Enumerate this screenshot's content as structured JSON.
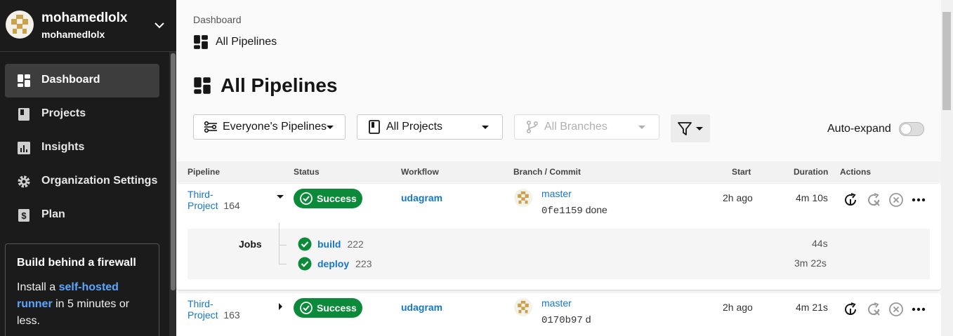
{
  "org": {
    "name": "mohamedlolx",
    "sub": "mohamedlolx"
  },
  "nav": [
    {
      "label": "Dashboard",
      "icon": "dashboard-icon",
      "active": true
    },
    {
      "label": "Projects",
      "icon": "book-icon"
    },
    {
      "label": "Insights",
      "icon": "bar-chart-icon"
    },
    {
      "label": "Organization Settings",
      "icon": "gear-icon"
    },
    {
      "label": "Plan",
      "icon": "dollar-icon"
    }
  ],
  "promo": {
    "title": "Build behind a firewall",
    "text_pre": "Install a ",
    "link": "self-hosted runner",
    "text_post": " in 5 minutes or less."
  },
  "breadcrumb": "Dashboard",
  "subheader": "All Pipelines",
  "title": "All Pipelines",
  "filters": {
    "pipelines": "Everyone's Pipelines",
    "projects": "All Projects",
    "branches": "All Branches"
  },
  "auto_expand": {
    "label": "Auto-expand",
    "on": false
  },
  "columns": {
    "pipeline": "Pipeline",
    "status": "Status",
    "workflow": "Workflow",
    "branch": "Branch / Commit",
    "start": "Start",
    "duration": "Duration",
    "actions": "Actions"
  },
  "rows": [
    {
      "project_line1": "Third-",
      "project_line2": "Project",
      "number": "164",
      "status": "Success",
      "workflow": "udagram",
      "branch": "master",
      "sha": "0fe1159",
      "message": "done",
      "start": "2h ago",
      "duration": "4m 10s",
      "jobs_label": "Jobs",
      "jobs": [
        {
          "name": "build",
          "number": "222",
          "duration": "44s"
        },
        {
          "name": "deploy",
          "number": "223",
          "duration": "3m 22s"
        }
      ]
    },
    {
      "project_line1": "Third-",
      "project_line2": "Project",
      "number": "163",
      "status": "Success",
      "workflow": "udagram",
      "branch": "master",
      "sha": "0170b97",
      "message": "d",
      "start": "2h ago",
      "duration": "4m 21s"
    }
  ],
  "colors": {
    "accent": "#1577c9",
    "success": "#0b8a3a",
    "sidebar": "#1b1b1b"
  }
}
